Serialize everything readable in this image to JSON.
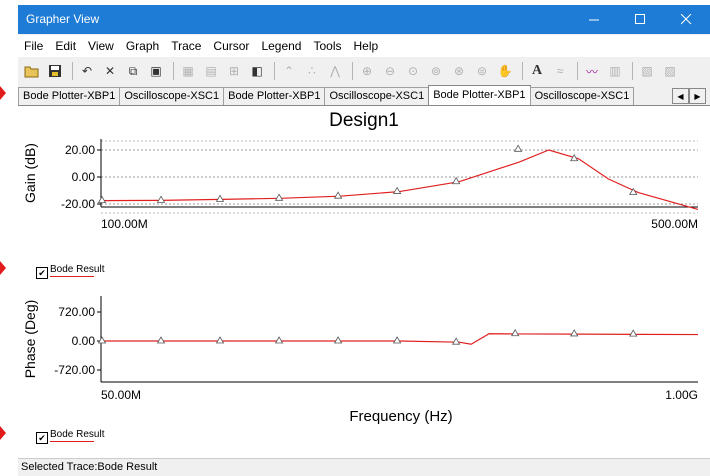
{
  "window": {
    "title": "Grapher View"
  },
  "menu": [
    "File",
    "Edit",
    "View",
    "Graph",
    "Trace",
    "Cursor",
    "Legend",
    "Tools",
    "Help"
  ],
  "tabs": [
    {
      "label": "Bode Plotter-XBP1",
      "active": false
    },
    {
      "label": "Oscilloscope-XSC1",
      "active": false
    },
    {
      "label": "Bode Plotter-XBP1",
      "active": false
    },
    {
      "label": "Oscilloscope-XSC1",
      "active": false
    },
    {
      "label": "Bode Plotter-XBP1",
      "active": true
    },
    {
      "label": "Oscilloscope-XSC1",
      "active": false
    }
  ],
  "graph": {
    "title": "Design1",
    "gain_axis_label": "Gain (dB)",
    "gain_ticks": [
      "20.00",
      "0.00",
      "-20.00"
    ],
    "gain_x_start": "100.00M",
    "gain_x_end": "500.00M",
    "phase_axis_label": "Phase (Deg)",
    "phase_ticks": [
      "720.00",
      "0.00",
      "-720.00"
    ],
    "phase_x_start": "50.00M",
    "phase_x_end": "1.00G",
    "x_axis_label": "Frequency (Hz)"
  },
  "legend": {
    "label": "Bode Result",
    "color": "#e02020"
  },
  "status": "Selected Trace:Bode Result",
  "chart_data": [
    {
      "type": "line",
      "ylabel": "Gain (dB)",
      "xlim": [
        "100.00M",
        "500.00M"
      ],
      "ylim": [
        -20,
        20
      ],
      "grid": true,
      "x": [
        0.0,
        0.1,
        0.2,
        0.3,
        0.4,
        0.5,
        0.6,
        0.7,
        0.75,
        0.8,
        0.85,
        0.9,
        1.0
      ],
      "series": [
        {
          "name": "Bode Result",
          "values": [
            -17.5,
            -17.3,
            -16.6,
            -15.8,
            -14.2,
            -10.8,
            -3.5,
            11.0,
            20.0,
            13.5,
            -1.5,
            -11.5,
            -24.0
          ]
        }
      ]
    },
    {
      "type": "line",
      "ylabel": "Phase (Deg)",
      "xlim": [
        "50.00M",
        "1.00G"
      ],
      "ylim": [
        -720,
        720
      ],
      "grid": false,
      "x": [
        0.0,
        0.1,
        0.2,
        0.3,
        0.4,
        0.5,
        0.6,
        0.62,
        0.65,
        0.7,
        0.8,
        0.9,
        1.0
      ],
      "series": [
        {
          "name": "Bode Result",
          "values": [
            0,
            0,
            0,
            0,
            0,
            0,
            -30,
            -80,
            180,
            175,
            170,
            165,
            160
          ]
        }
      ]
    }
  ],
  "icons": [
    "open-folder",
    "save",
    "undo",
    "delete",
    "copy",
    "paste",
    "grid",
    "legend",
    "cursors",
    "overlay",
    "show-select-marks",
    "show-dots",
    "show-triangles",
    "zoom-in",
    "zoom-out",
    "zoom-area",
    "zoom-x",
    "zoom-y",
    "zoom-full",
    "pan",
    "font",
    "toggle-compression",
    "toggle-background",
    "export-to-excel",
    "print",
    "print-preview"
  ]
}
